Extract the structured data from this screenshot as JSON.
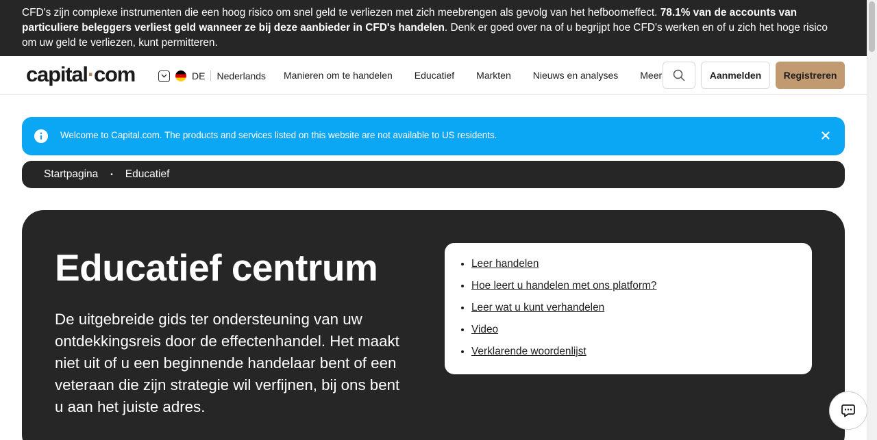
{
  "risk_banner": {
    "text_start": "CFD's zijn complexe instrumenten die een hoog risico om snel geld te verliezen met zich meebrengen als gevolg van het hefboomeffect. ",
    "text_bold": "78.1% van de accounts van particuliere beleggers verliest geld wanneer ze bij deze aanbieder in CFD's handelen",
    "text_end": ". Denk er goed over na of u begrijpt hoe CFD's werken en of u zich het hoge risico om uw geld te verliezen, kunt permitteren."
  },
  "header": {
    "logo_left": "capital",
    "logo_dot": "·",
    "logo_right": "com",
    "lang_code": "DE",
    "language": "Nederlands",
    "nav": [
      "Manieren om te handelen",
      "Educatief",
      "Markten",
      "Nieuws en analyses",
      "Meer"
    ],
    "login_label": "Aanmelden",
    "register_label": "Registreren"
  },
  "notice": {
    "text": "Welcome to Capital.com. The products and services listed on this website are not available to US residents."
  },
  "breadcrumb": {
    "items": [
      "Startpagina",
      "Educatief"
    ],
    "separator": "•"
  },
  "hero": {
    "title": "Educatief centrum",
    "description": "De uitgebreide gids ter ondersteuning van uw ontdekkingsreis door de effectenhandel. Het maakt niet uit of u een beginnende handelaar bent of een veteraan die zijn strategie wil verfijnen, bij ons bent u aan het juiste adres.",
    "links": [
      "Leer handelen",
      "Hoe leert u handelen met ons platform?",
      "Leer wat u kunt verhandelen",
      "Video",
      "Verklarende woordenlijst"
    ]
  },
  "colors": {
    "dark": "#262626",
    "brand_gold": "#c29a72",
    "notice_blue": "#0ba7f5"
  }
}
